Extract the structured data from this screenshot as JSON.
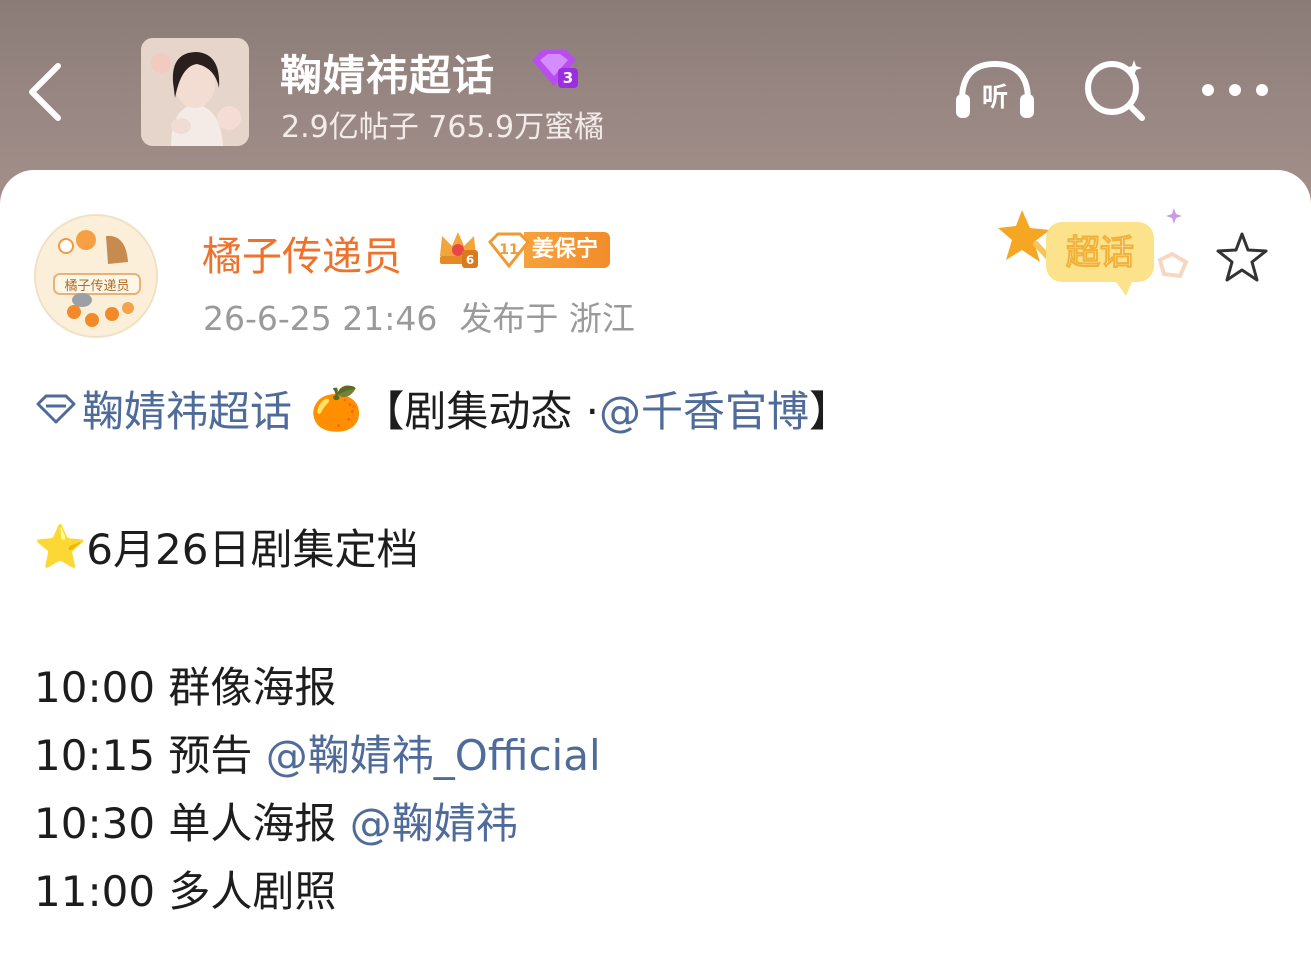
{
  "header": {
    "topic_title": "鞠婧祎超话",
    "level_badge": "3",
    "stats": "2.9亿帖子 765.9万蜜橘",
    "listen_label": "听"
  },
  "post": {
    "author": "橘子传递员",
    "crown_level": "6",
    "fan_level": "11",
    "fan_group": "姜保宁",
    "avatar_text": "橘子传递员",
    "time": "26-6-25 21:46",
    "location": "发布于 浙江",
    "sticker_text": "超话",
    "line1": {
      "topic_link": "鞠婧祎超话",
      "emoji": "🍊",
      "bracket_open": "【剧集动态 ·",
      "mention": "@千香官博",
      "bracket_close": "】"
    },
    "line2": {
      "emoji": "⭐",
      "text": "6月26日剧集定档"
    },
    "schedule": [
      {
        "time": "10:00",
        "label": "群像海报",
        "mention": ""
      },
      {
        "time": "10:15",
        "label": "预告",
        "mention": "@鞠婧祎_Official"
      },
      {
        "time": "10:30",
        "label": "单人海报",
        "mention": "@鞠婧祎"
      },
      {
        "time": "11:00",
        "label": "多人剧照",
        "mention": ""
      }
    ]
  },
  "colors": {
    "header_bg": "#8b7c78",
    "author": "#f0712b",
    "link": "#4f6b99",
    "meta": "#9a9a9a",
    "badge_purple": "#b84ef0"
  }
}
